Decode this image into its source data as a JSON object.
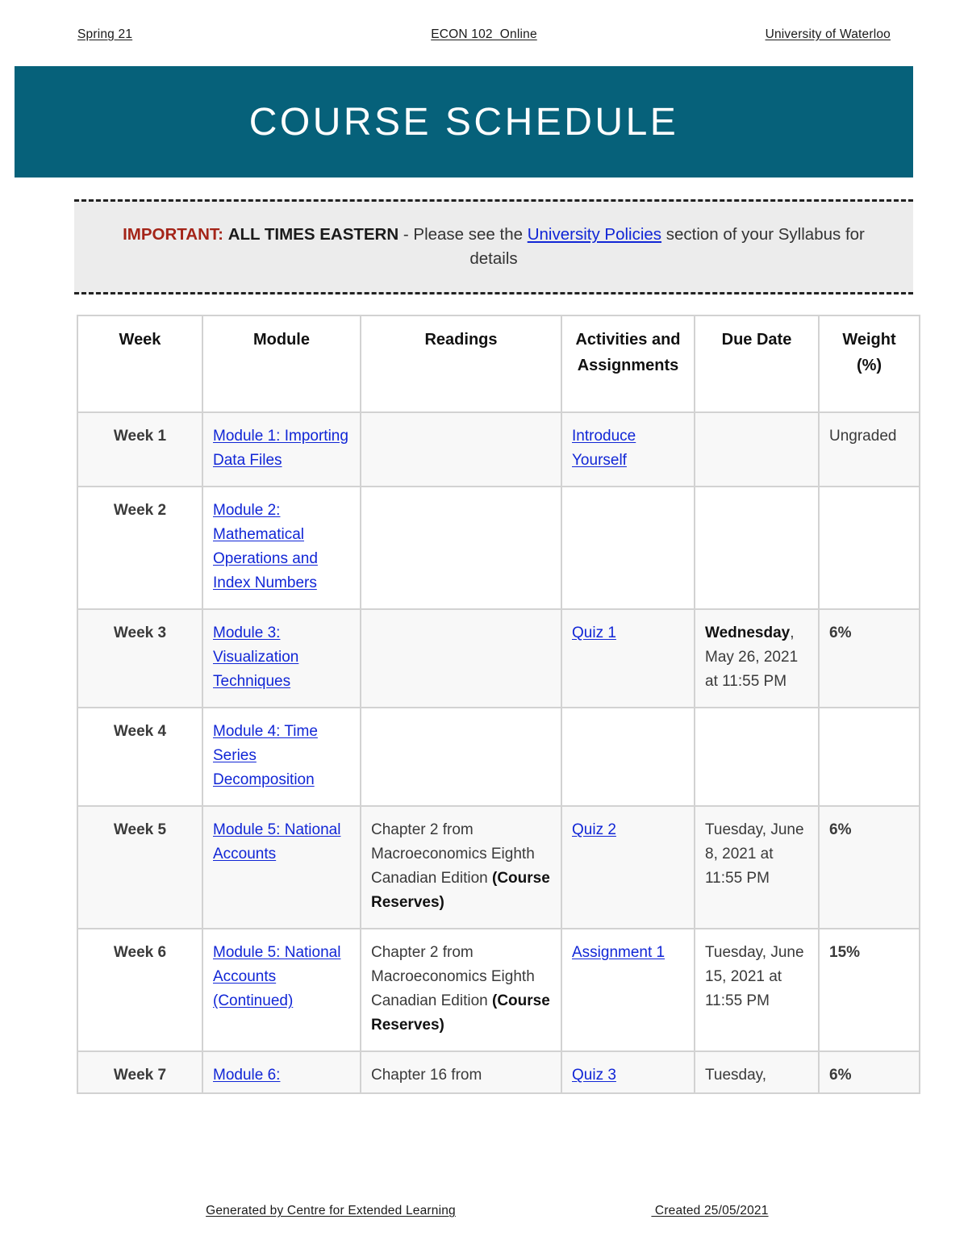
{
  "page_header": {
    "left": "Spring 21",
    "center": "ECON 102  Online",
    "right": "University of Waterloo"
  },
  "banner": {
    "title": "COURSE SCHEDULE",
    "background_color": "#06617a",
    "text_color": "#ffffff"
  },
  "notice": {
    "important_label": "IMPORTANT:",
    "important_color": "#a42418",
    "emphasis": "ALL TIMES EASTERN",
    "middle_text": " - Please see the ",
    "link_text": "University Policies",
    "link_color": "#1126d6",
    "tail_text": " section of your Syllabus for details",
    "background_color": "#ececec"
  },
  "table": {
    "columns": [
      "Week",
      "Module",
      "Readings",
      "Activities and Assignments",
      "Due Date",
      "Weight (%)"
    ],
    "rows": [
      {
        "week": "Week 1",
        "module": "Module 1: Importing Data Files",
        "module_is_link": true,
        "readings": "",
        "readings_bold": "",
        "activity": "Introduce Yourself",
        "activity_is_link": true,
        "due_bold": "",
        "due_rest": "",
        "weight": "Ungraded",
        "weight_bold": false
      },
      {
        "week": "Week 2",
        "module": "Module 2: Mathematical Operations and Index Numbers",
        "module_is_link": true,
        "readings": "",
        "readings_bold": "",
        "activity": "",
        "activity_is_link": false,
        "due_bold": "",
        "due_rest": "",
        "weight": "",
        "weight_bold": false
      },
      {
        "week": "Week 3",
        "module": "Module 3: Visualization Techniques",
        "module_is_link": true,
        "readings": "",
        "readings_bold": "",
        "activity": "Quiz 1",
        "activity_is_link": true,
        "due_bold": "Wednesday",
        "due_rest": ", May 26, 2021 at 11:55 PM",
        "weight": "6%",
        "weight_bold": true
      },
      {
        "week": "Week 4",
        "module": "Module 4: Time Series Decomposition",
        "module_is_link": true,
        "readings": "",
        "readings_bold": "",
        "activity": "",
        "activity_is_link": false,
        "due_bold": "",
        "due_rest": "",
        "weight": "",
        "weight_bold": false
      },
      {
        "week": "Week 5",
        "module": "Module 5: National Accounts",
        "module_is_link": true,
        "readings": "Chapter 2 from Macroeconomics Eighth Canadian Edition ",
        "readings_bold": "(Course Reserves)",
        "activity": "Quiz 2",
        "activity_is_link": true,
        "due_bold": "",
        "due_rest": "Tuesday, June 8, 2021 at 11:55 PM",
        "weight": "6%",
        "weight_bold": true
      },
      {
        "week": "Week 6",
        "module": "Module 5: National Accounts (Continued)",
        "module_is_link": true,
        "readings": "Chapter 2 from Macroeconomics Eighth Canadian Edition ",
        "readings_bold": "(Course Reserves)",
        "activity": "Assignment 1",
        "activity_is_link": true,
        "due_bold": "",
        "due_rest": "Tuesday, June 15, 2021 at 11:55 PM",
        "weight": "15%",
        "weight_bold": true
      },
      {
        "week": "Week 7",
        "module": "Module 6:",
        "module_is_link": true,
        "readings": "Chapter 16 from",
        "readings_bold": "",
        "activity": "Quiz 3",
        "activity_is_link": true,
        "due_bold": "",
        "due_rest": "Tuesday,",
        "weight": "6%",
        "weight_bold": true
      }
    ]
  },
  "page_footer": {
    "left": "Generated by Centre for Extended Learning",
    "right": " Created 25/05/2021"
  }
}
